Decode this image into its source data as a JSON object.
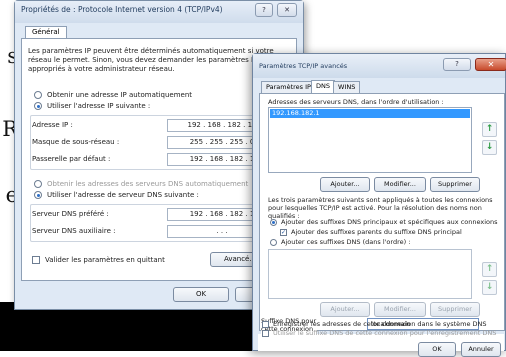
{
  "background": {
    "letters": [
      "s",
      "R",
      "e"
    ]
  },
  "win1": {
    "title": "Propriétés de : Protocole Internet version 4 (TCP/IPv4)",
    "help": "?",
    "close": "✕",
    "tab": "Général",
    "description": "Les paramètres IP peuvent être déterminés automatiquement si votre réseau le permet. Sinon, vous devez demander les paramètres IP appropriés à votre administrateur réseau.",
    "radio_auto_ip": "Obtenir une adresse IP automatiquement",
    "radio_manual_ip": "Utiliser l'adresse IP suivante :",
    "ip_label": "Adresse IP :",
    "ip_value": "192 . 168 . 182 . 10",
    "mask_label": "Masque de sous-réseau :",
    "mask_value": "255 . 255 . 255 . 0",
    "gateway_label": "Passerelle par défaut :",
    "gateway_value": "192 . 168 . 182 . 1",
    "radio_auto_dns": "Obtenir les adresses des serveurs DNS automatiquement",
    "radio_manual_dns": "Utiliser l'adresse de serveur DNS suivante :",
    "dns_pref_label": "Serveur DNS préféré :",
    "dns_pref_value": "192 . 168 . 182 . 1",
    "dns_alt_label": "Serveur DNS auxiliaire :",
    "dns_alt_value": ".      .      .",
    "validate_label": "Valider les paramètres en quittant",
    "advanced_button": "Avancé...",
    "ok_button": "OK",
    "cancel_button": "Annu"
  },
  "win2": {
    "title": "Paramètres TCP/IP avancés",
    "help": "?",
    "close": "✕",
    "tabs": [
      "Paramètres IP",
      "DNS",
      "WINS"
    ],
    "dns_list_label": "Adresses des serveurs DNS, dans l'ordre d'utilisation :",
    "dns_list": [
      "192.168.182.1"
    ],
    "up_arrow": "↑",
    "down_arrow": "↓",
    "add_button": "Ajouter...",
    "modify_button": "Modifier...",
    "remove_button": "Supprimer",
    "info_text": "Les trois paramètres suivants sont appliqués à toutes les connexions pour lesquelles TCP/IP est activé. Pour la résolution des noms non qualifiés :",
    "radio_primary_suffix": "Ajouter des suffixes DNS principaux et spécifiques aux connexions",
    "checkbox_parent_suffix": "Ajouter des suffixes parents du suffixe DNS principal",
    "radio_these_suffix": "Ajouter ces suffixes DNS (dans l'ordre) :",
    "add_button2": "Ajouter...",
    "modify_button2": "Modifier...",
    "remove_button2": "Supprimer",
    "suffix_label": "Suffixe DNS pour cette connexion :",
    "suffix_value": "localdomain",
    "register_label": "Enregistrer les adresses de cette connexion dans le système DNS",
    "use_suffix_label": "Utiliser le suffixe DNS de cette connexion pour l'enregistrement DNS",
    "ok_button": "OK",
    "cancel_button": "Annuler"
  }
}
